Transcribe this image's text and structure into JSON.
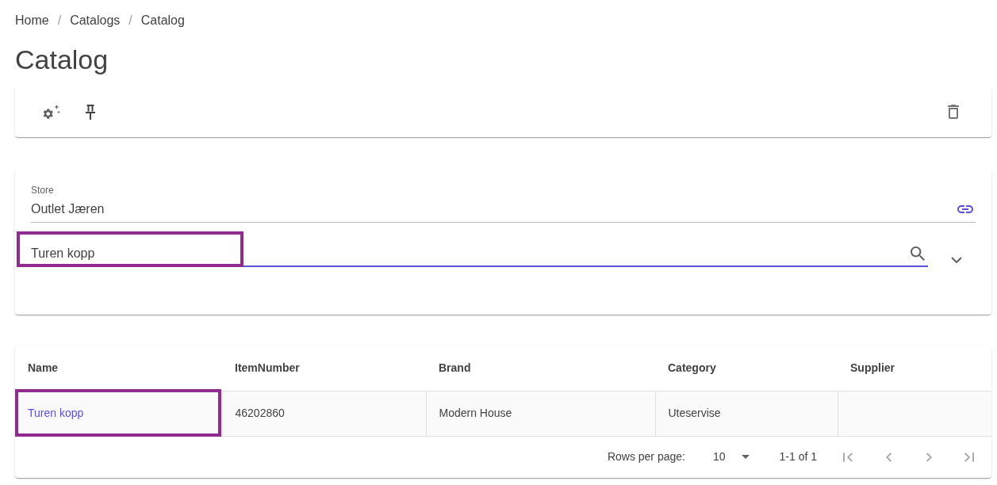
{
  "breadcrumb": {
    "items": [
      "Home",
      "Catalogs",
      "Catalog"
    ],
    "separators": [
      "/",
      "/"
    ]
  },
  "title": "Catalog",
  "filters": {
    "store": {
      "label": "Store",
      "value": "Outlet Jæren"
    },
    "search": {
      "value": "Turen kopp",
      "focused": true,
      "highlighted": true
    }
  },
  "table": {
    "columns": [
      "Name",
      "ItemNumber",
      "Brand",
      "Category",
      "Supplier"
    ],
    "rows": [
      {
        "cells": [
          {
            "text": "Turen kopp",
            "link": true,
            "highlighted": true
          },
          {
            "text": "46202860",
            "link": false,
            "highlighted": false
          },
          {
            "text": "Modern House",
            "link": false,
            "highlighted": false
          },
          {
            "text": "Uteservise",
            "link": false,
            "highlighted": false
          }
        ]
      }
    ]
  },
  "pagination": {
    "rows_per_page_label": "Rows per page:",
    "rows_per_page": "10",
    "range": "1-1 of 1",
    "buttons": [
      {
        "kind": "first",
        "disabled": true
      },
      {
        "kind": "previous",
        "disabled": true
      },
      {
        "kind": "next",
        "disabled": true
      },
      {
        "kind": "last",
        "disabled": true
      }
    ]
  }
}
